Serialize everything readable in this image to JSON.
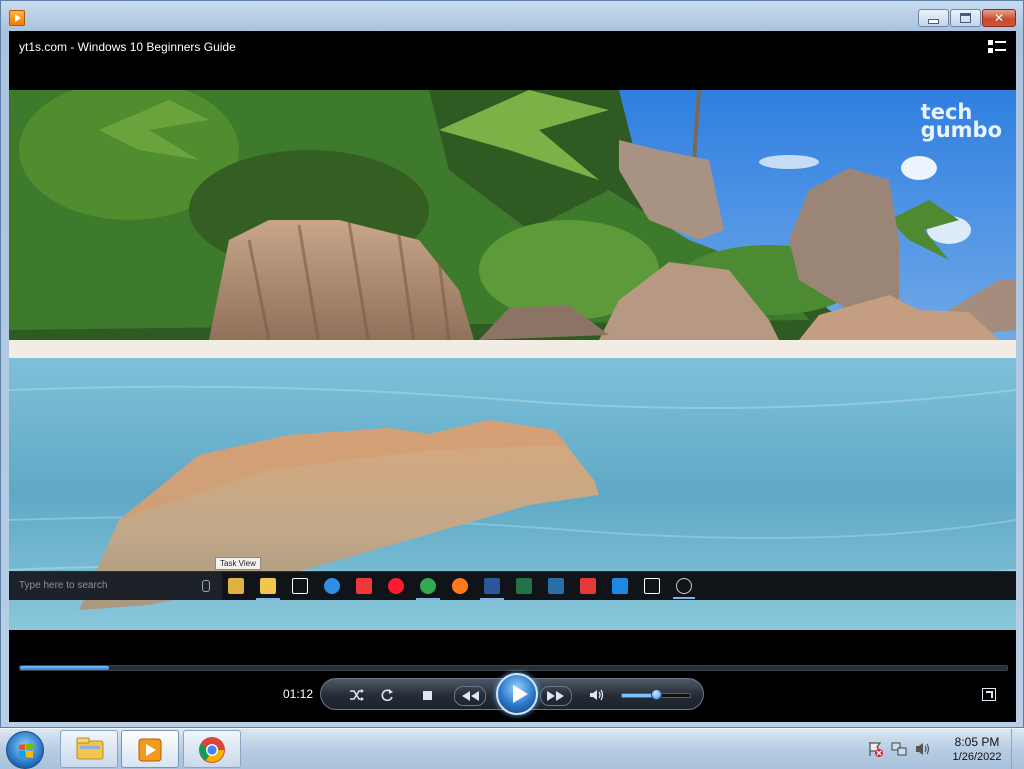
{
  "window": {
    "title": "",
    "min_label": "—",
    "close_label": "✕"
  },
  "video": {
    "title": "yt1s.com - Windows 10 Beginners Guide",
    "watermark_line1": "tech",
    "watermark_line2": "gumbo"
  },
  "video_taskbar": {
    "search_placeholder": "Type here to search",
    "tooltip": "Task View",
    "icons": [
      {
        "name": "task-view-icon",
        "color": "#e0b040"
      },
      {
        "name": "file-explorer-icon",
        "color": "#f2c54b"
      },
      {
        "name": "store-icon",
        "color": "#ffffff"
      },
      {
        "name": "edge-icon",
        "color": "#2f8fe6"
      },
      {
        "name": "vivaldi-icon",
        "color": "#ef3939"
      },
      {
        "name": "opera-icon",
        "color": "#ff1b2d"
      },
      {
        "name": "chrome-icon",
        "color": "#34a853"
      },
      {
        "name": "firefox-icon",
        "color": "#ff7a1a"
      },
      {
        "name": "word-icon",
        "color": "#2b579a"
      },
      {
        "name": "excel-icon",
        "color": "#217346"
      },
      {
        "name": "steam-icon",
        "color": "#2a6ea8"
      },
      {
        "name": "vpn-icon",
        "color": "#e53935"
      },
      {
        "name": "playstation-icon",
        "color": "#1e88e5"
      },
      {
        "name": "7zip-icon",
        "color": "#ffffff"
      },
      {
        "name": "obs-icon",
        "color": "#cccccc"
      }
    ]
  },
  "player": {
    "time": "01:12",
    "seek_progress": 0.09,
    "volume": 0.5,
    "accent": "#2c7fd4"
  },
  "os_taskbar": {
    "apps": [
      {
        "name": "windows-explorer-icon"
      },
      {
        "name": "media-player-icon"
      },
      {
        "name": "chrome-icon"
      }
    ],
    "time": "8:05 PM",
    "date": "1/26/2022"
  }
}
